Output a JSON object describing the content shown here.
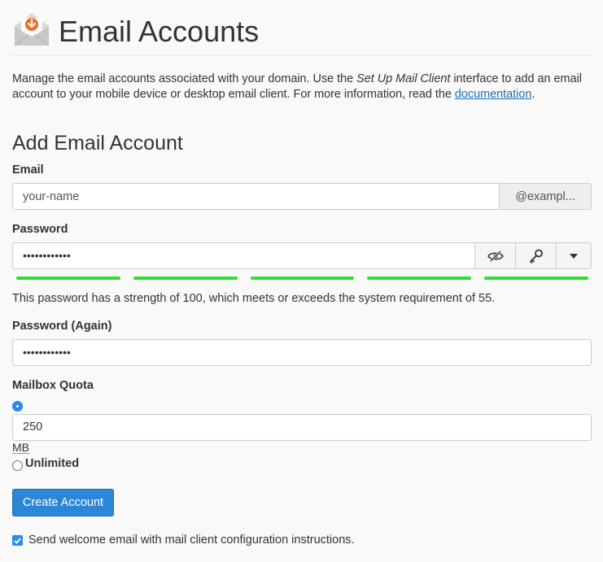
{
  "header": {
    "title": "Email Accounts",
    "icon": "envelope-download-icon"
  },
  "intro": {
    "text_before": "Manage the email accounts associated with your domain. Use the ",
    "emphasis": "Set Up Mail Client",
    "text_middle": " interface to add an email account to your mobile device or desktop email client. For more information, read the ",
    "link_text": "documentation",
    "text_after": "."
  },
  "form": {
    "section_title": "Add Email Account",
    "email": {
      "label": "Email",
      "placeholder": "your-name",
      "domain_addon": "@exampl..."
    },
    "password": {
      "label": "Password",
      "value_masked": "••••••••••••",
      "strength_segments": 5,
      "strength_message": "This password has a strength of 100, which meets or exceeds the system requirement of 55."
    },
    "password_again": {
      "label": "Password (Again)",
      "value_masked": "••••••••••••"
    },
    "quota": {
      "label": "Mailbox Quota",
      "value": "250",
      "unit": "MB",
      "unlimited_label": "Unlimited",
      "selected": "limited"
    },
    "submit_label": "Create Account",
    "welcome_email": {
      "checked": true,
      "label": "Send welcome email with mail client configuration instructions."
    }
  },
  "colors": {
    "accent": "#2b86d6",
    "icon_orange": "#f06a25",
    "strength_bar": "#2ee02e",
    "link": "#1a6fb5"
  }
}
